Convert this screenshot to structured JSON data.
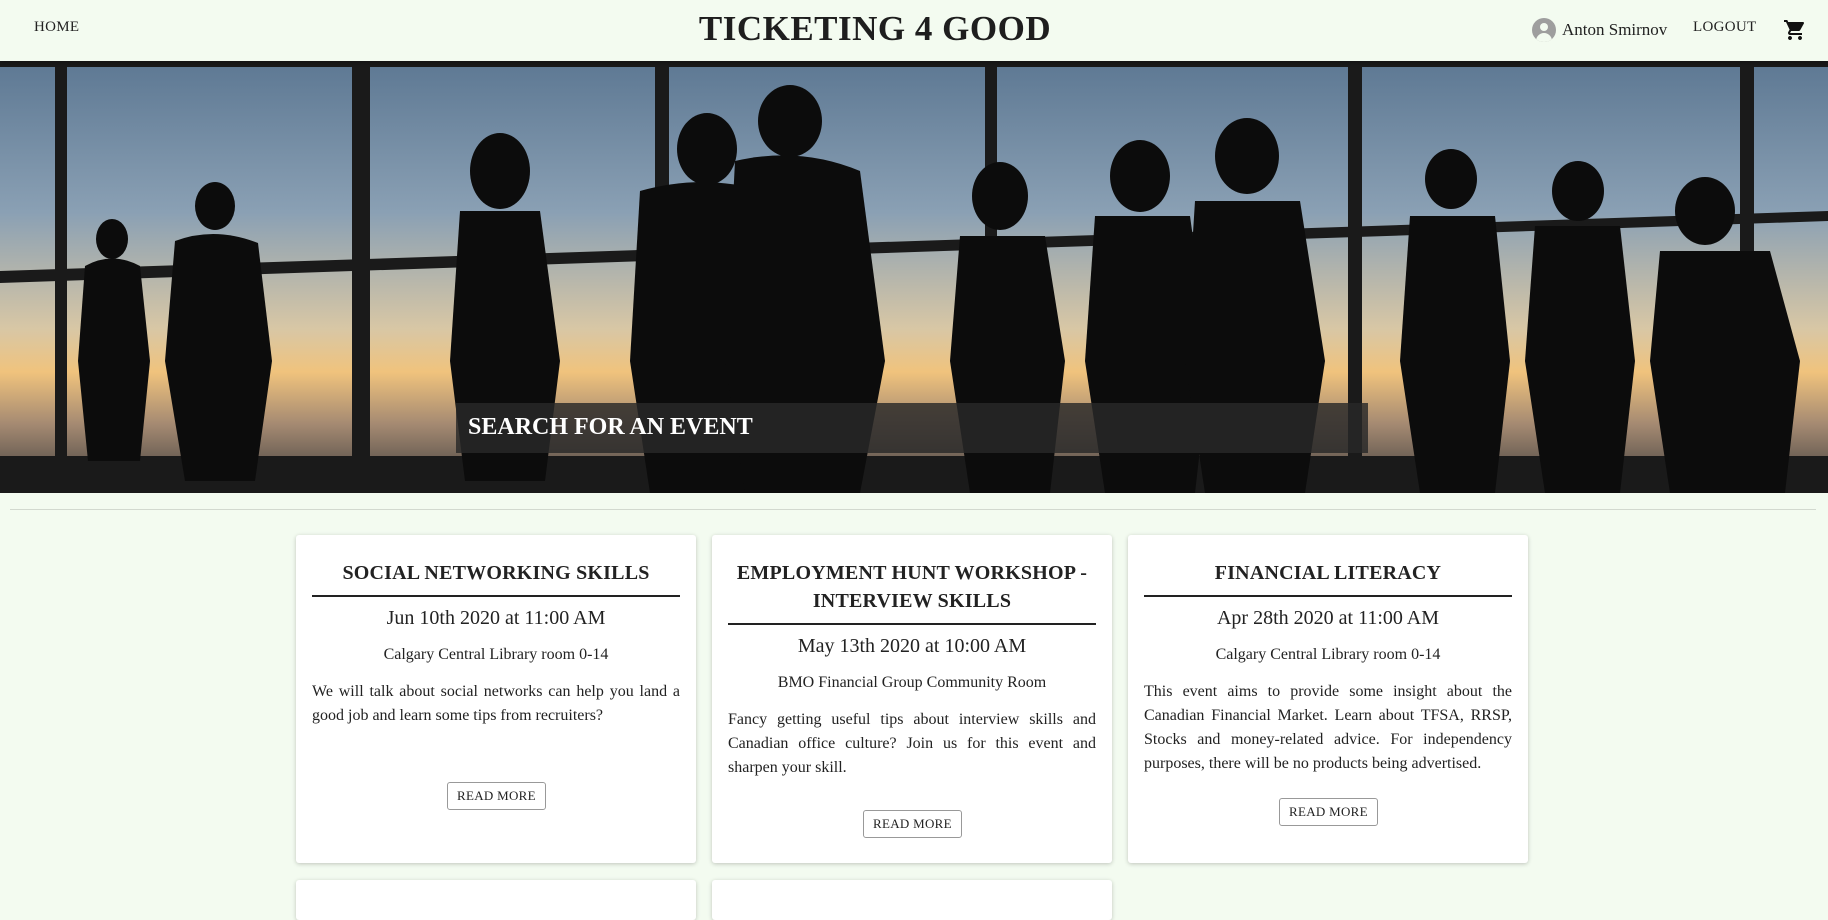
{
  "nav": {
    "home": "HOME",
    "title": "TICKETING 4 GOOD",
    "user_name": "Anton Smirnov",
    "logout": "LOGOUT"
  },
  "hero": {
    "search_placeholder": "SEARCH FOR AN EVENT"
  },
  "events": [
    {
      "title": "SOCIAL NETWORKING SKILLS",
      "date": "Jun 10th 2020 at 11:00 AM",
      "location": "Calgary Central Library room 0-14",
      "description": "We will talk about social networks can help you land a good job and learn some tips from recruiters?",
      "button": "READ MORE"
    },
    {
      "title": "EMPLOYMENT HUNT WORKSHOP - INTERVIEW SKILLS",
      "date": "May 13th 2020 at 10:00 AM",
      "location": "BMO Financial Group Community Room",
      "description": "Fancy getting useful tips about interview skills and Canadian office culture? Join us for this event and sharpen your skill.",
      "button": "READ MORE"
    },
    {
      "title": "FINANCIAL LITERACY",
      "date": "Apr 28th 2020 at 11:00 AM",
      "location": "Calgary Central Library room 0-14",
      "description": "This event aims to provide some insight about the Canadian Financial Market. Learn about TFSA, RRSP, Stocks and money-related advice. For independency purposes, there will be no products being advertised.",
      "button": "READ MORE"
    }
  ],
  "colors": {
    "page_background": "#f3fbf0",
    "card_background": "#ffffff",
    "search_overlay": "#282828"
  }
}
